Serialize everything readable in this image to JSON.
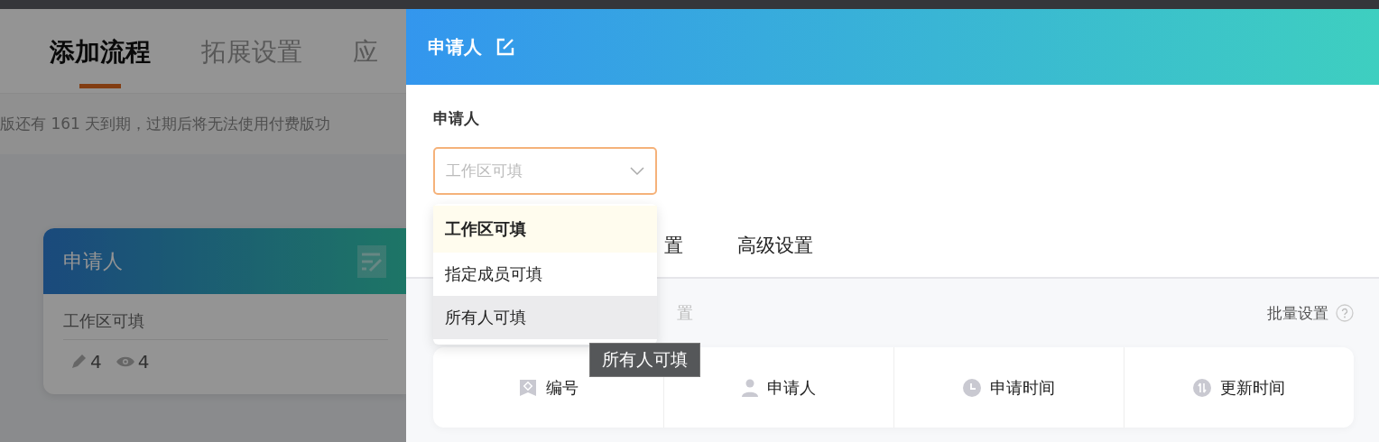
{
  "background": {
    "tabs": [
      {
        "label": "添加流程",
        "selected": true
      },
      {
        "label": "拓展设置",
        "selected": false
      },
      {
        "label": "应",
        "selected": false
      }
    ],
    "notice": "版还有 161 天到期，过期后将无法使用付费版功",
    "node_card": {
      "title": "申请人",
      "subtitle": "工作区可填",
      "edit_count": "4",
      "view_count": "4"
    }
  },
  "drawer": {
    "title": "申请人",
    "field_label": "申请人",
    "select": {
      "placeholder": "工作区可填"
    },
    "options": [
      {
        "label": "工作区可填",
        "selected": true,
        "hovered": false
      },
      {
        "label": "指定成员可填",
        "selected": false,
        "hovered": false
      },
      {
        "label": "所有人可填",
        "selected": false,
        "hovered": true
      }
    ],
    "tooltip": "所有人可填",
    "tabs": [
      {
        "label": "置"
      },
      {
        "label": "高级设置"
      }
    ],
    "section_hint": "置",
    "batch_label": "批量设置",
    "columns": [
      {
        "label": "编号",
        "kind": "number"
      },
      {
        "label": "申请人",
        "kind": "person"
      },
      {
        "label": "申请时间",
        "kind": "time"
      },
      {
        "label": "更新时间",
        "kind": "update"
      }
    ]
  }
}
